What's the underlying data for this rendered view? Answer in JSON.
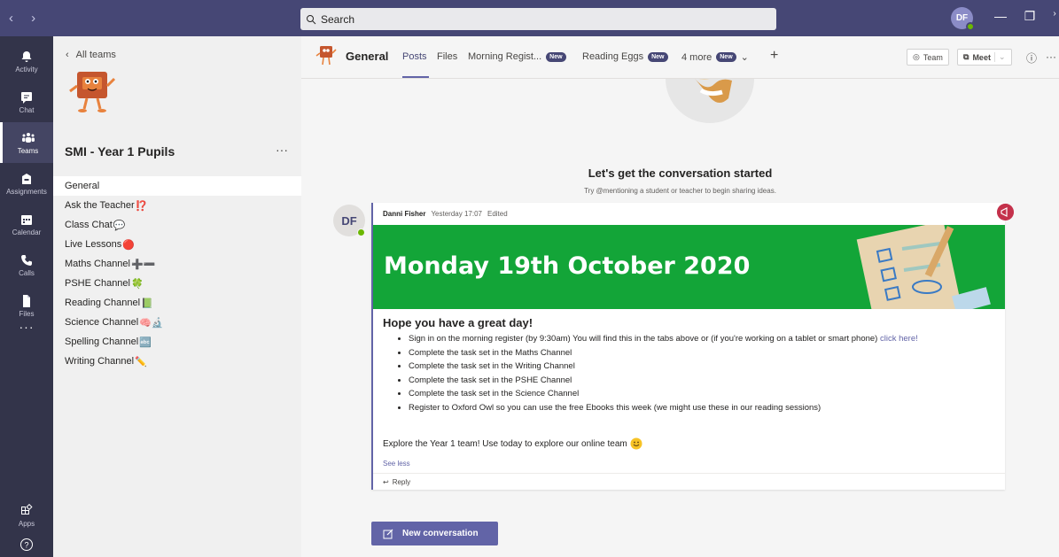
{
  "topbar": {
    "nav_arrows": "‹ ›",
    "search_placeholder": "Search",
    "avatar_initials": "DF",
    "minimize": "—",
    "maximize": "❐",
    "close": "✕"
  },
  "rail": {
    "items": [
      {
        "label": "Activity",
        "icon": "bell-icon"
      },
      {
        "label": "Chat",
        "icon": "chat-icon"
      },
      {
        "label": "Teams",
        "icon": "teams-icon"
      },
      {
        "label": "Assignments",
        "icon": "assignments-icon"
      },
      {
        "label": "Calendar",
        "icon": "calendar-icon"
      },
      {
        "label": "Calls",
        "icon": "phone-icon"
      },
      {
        "label": "Files",
        "icon": "file-icon"
      }
    ],
    "more": "···",
    "apps_label": "Apps",
    "help_label": "Help"
  },
  "team_pane": {
    "back_label": "All teams",
    "team_name": "SMI - Year 1 Pupils",
    "more": "···",
    "channels": [
      {
        "name": "General",
        "emoji": ""
      },
      {
        "name": "Ask the Teacher",
        "emoji": "⁉️"
      },
      {
        "name": "Class Chat",
        "emoji": "💬"
      },
      {
        "name": "Live Lessons",
        "emoji": "🔴"
      },
      {
        "name": "Maths Channel",
        "emoji": "➕➖"
      },
      {
        "name": "PSHE Channel",
        "emoji": "🍀"
      },
      {
        "name": "Reading Channel",
        "emoji": "📗"
      },
      {
        "name": "Science Channel",
        "emoji": "🧠🔬"
      },
      {
        "name": "Spelling Channel",
        "emoji": "🔤"
      },
      {
        "name": "Writing Channel",
        "emoji": "✏️"
      }
    ]
  },
  "header": {
    "channel": "General",
    "tabs": {
      "posts": "Posts",
      "files": "Files",
      "morning": "Morning Regist...",
      "reading": "Reading Eggs",
      "more": "4 more",
      "new_badge": "New"
    },
    "team_btn": "Team",
    "meet_btn": "Meet"
  },
  "welcome": {
    "title": "Let's get the conversation started",
    "subtitle": "Try @mentioning a student or teacher to begin sharing ideas."
  },
  "post": {
    "avatar": "DF",
    "author": "Danni Fisher",
    "time": "Yesterday 17:07",
    "edited": "Edited",
    "banner_title": "Monday 19th October 2020",
    "heading": "Hope you have a great day!",
    "items": [
      "Sign in on the morning register (by 9:30am) You will find this in the tabs above or (if you're working on a tablet or smart phone)",
      "Complete the task set in the Maths Channel",
      "Complete the task set in the Writing Channel",
      "Complete the task set in the PSHE Channel",
      "Complete the task set in the Science Channel",
      "Register to Oxford Owl so you can use the free Ebooks this week (we might use these in our reading sessions)"
    ],
    "link_text": "click here!",
    "explore": "Explore the Year 1 team! Use today to explore our online team",
    "see_less": "See less",
    "reply": "Reply"
  },
  "new_conversation": "New conversation"
}
